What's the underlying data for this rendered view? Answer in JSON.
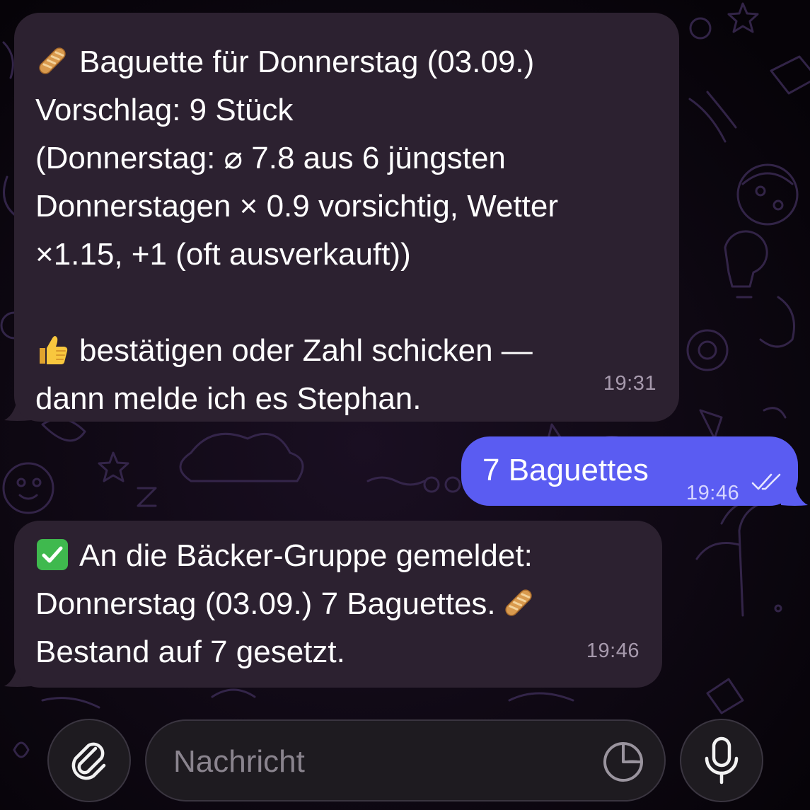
{
  "colors": {
    "background": "#0b0610",
    "incoming_bubble": "#2c2130",
    "outgoing_bubble": "#5a5cf2",
    "timestamp": "#a79aad",
    "input_background": "#1e1b20"
  },
  "messages": [
    {
      "direction": "incoming",
      "time": "19:31",
      "lines": [
        {
          "icon": "baguette-emoji",
          "text": "Baguette für Donnerstag (03.09.)"
        },
        {
          "text": "Vorschlag: 9 Stück"
        },
        {
          "text": "(Donnerstag: ⌀ 7.8 aus 6 jüngsten"
        },
        {
          "text": "Donnerstagen × 0.9 vorsichtig, Wetter"
        },
        {
          "text": "×1.15, +1 (oft ausverkauft))"
        },
        {
          "text": ""
        },
        {
          "icon": "thumbs-up-emoji",
          "text": "bestätigen oder Zahl schicken —"
        },
        {
          "text": "dann melde ich es Stephan."
        }
      ]
    },
    {
      "direction": "outgoing",
      "time": "19:46",
      "status": "read",
      "status_icon": "double-check-icon",
      "text": "7 Baguettes"
    },
    {
      "direction": "incoming",
      "time": "19:46",
      "lines": [
        {
          "icon": "check-mark-emoji",
          "text": "An die Bäcker-Gruppe gemeldet:"
        },
        {
          "text": "Donnerstag (03.09.) 7 Baguettes.",
          "trailing_icon": "baguette-emoji"
        },
        {
          "text": "Bestand auf 7 gesetzt."
        }
      ]
    }
  ],
  "composer": {
    "attach_icon": "paperclip-icon",
    "placeholder": "Nachricht",
    "value": "",
    "sticker_icon": "sticker-icon",
    "mic_icon": "microphone-icon"
  }
}
